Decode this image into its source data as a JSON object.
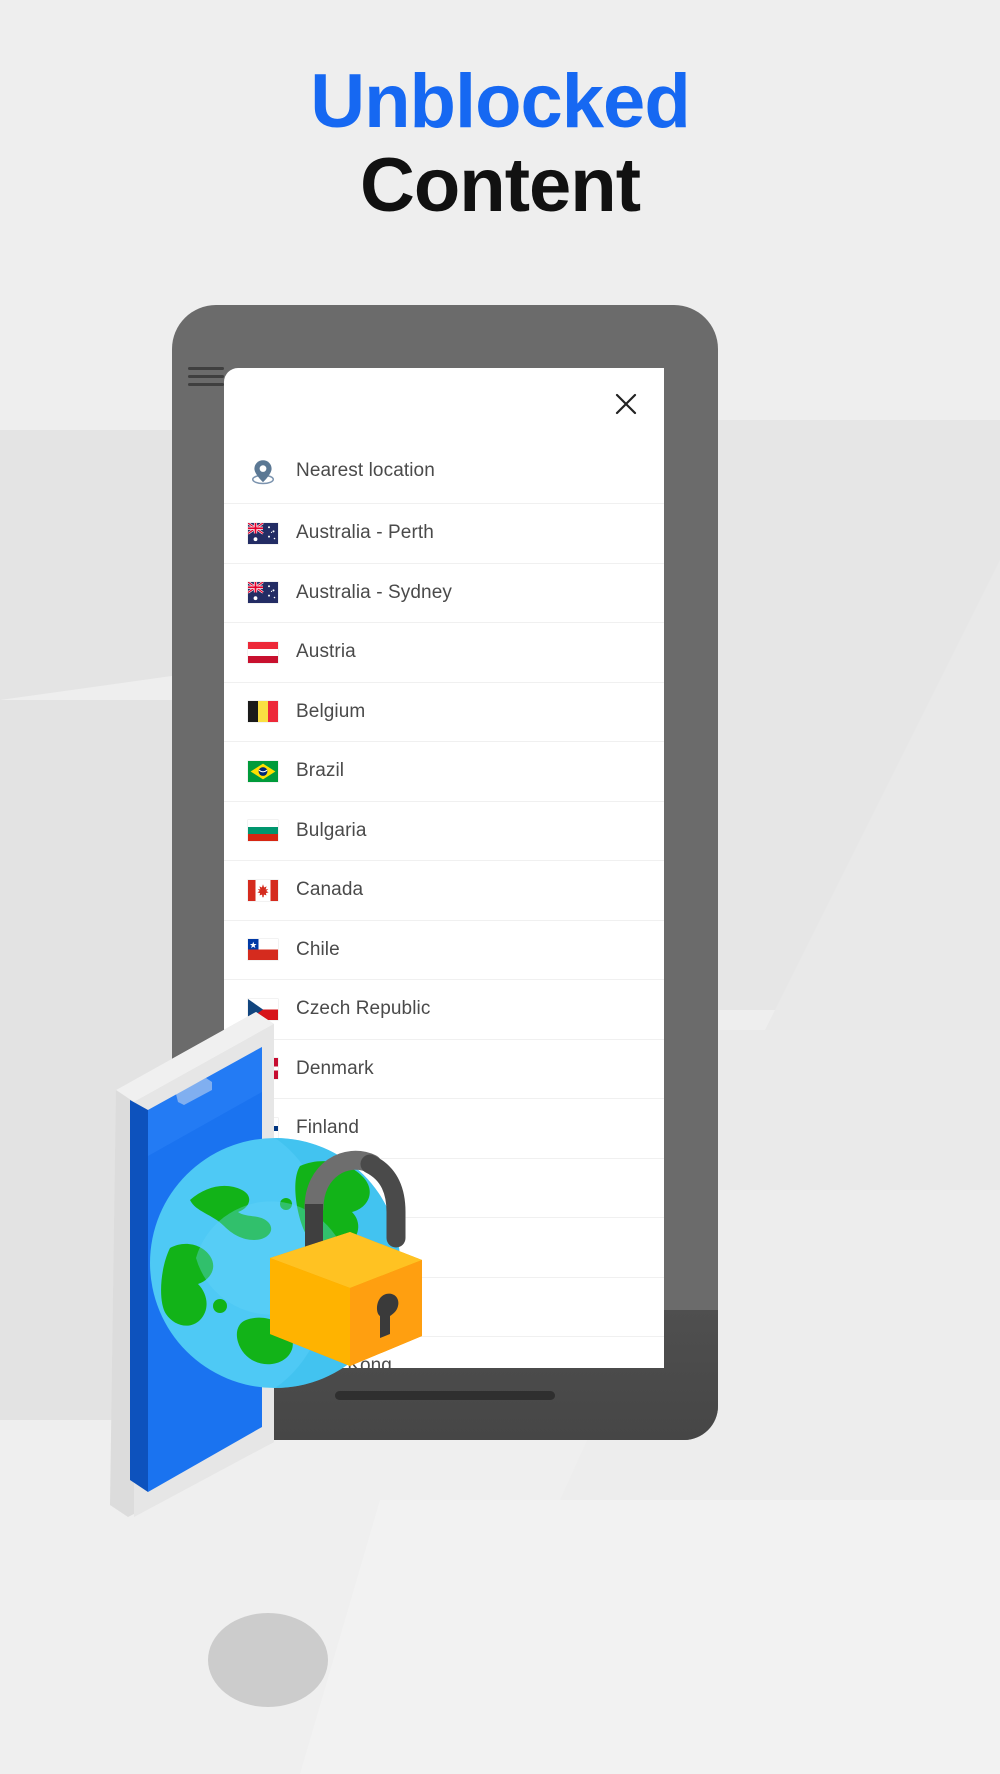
{
  "headline": {
    "line1": "Unblocked",
    "line2": "Content",
    "line1_color": "#1668f2",
    "line2_color": "#111111"
  },
  "device": {
    "name": "phone-mockup",
    "bezel_color": "#6b6b6b"
  },
  "panel": {
    "close_label": "×",
    "close_icon": "close-icon",
    "background": "#ffffff"
  },
  "server_list": {
    "items": [
      {
        "label": "Nearest location",
        "icon": "location-pin-icon",
        "flag": null
      },
      {
        "label": "Australia - Perth",
        "icon": "flag-icon",
        "flag": "au"
      },
      {
        "label": "Australia - Sydney",
        "icon": "flag-icon",
        "flag": "au"
      },
      {
        "label": "Austria",
        "icon": "flag-icon",
        "flag": "at"
      },
      {
        "label": "Belgium",
        "icon": "flag-icon",
        "flag": "be"
      },
      {
        "label": "Brazil",
        "icon": "flag-icon",
        "flag": "br"
      },
      {
        "label": "Bulgaria",
        "icon": "flag-icon",
        "flag": "bg"
      },
      {
        "label": "Canada",
        "icon": "flag-icon",
        "flag": "ca"
      },
      {
        "label": "Chile",
        "icon": "flag-icon",
        "flag": "cl"
      },
      {
        "label": "Czech Republic",
        "icon": "flag-icon",
        "flag": "cz"
      },
      {
        "label": "Denmark",
        "icon": "flag-icon",
        "flag": "dk"
      },
      {
        "label": "Finland",
        "icon": "flag-icon",
        "flag": "fi"
      },
      {
        "label": "",
        "icon": "flag-icon",
        "flag": "fr"
      },
      {
        "label": "",
        "icon": "flag-icon",
        "flag": "de"
      },
      {
        "label": "",
        "icon": "flag-icon",
        "flag": "gr"
      },
      {
        "label": "Hong Kong",
        "icon": "flag-icon",
        "flag": "hk"
      }
    ]
  },
  "illustration": {
    "globe": "globe-icon",
    "padlock": "padlock-icon",
    "phone_screen_color": "#1a73f0"
  },
  "colors": {
    "page_background": "#eeeeee",
    "accent_blue": "#1668f2",
    "row_text": "#4a4a4a",
    "divider": "#f0f0f0"
  }
}
